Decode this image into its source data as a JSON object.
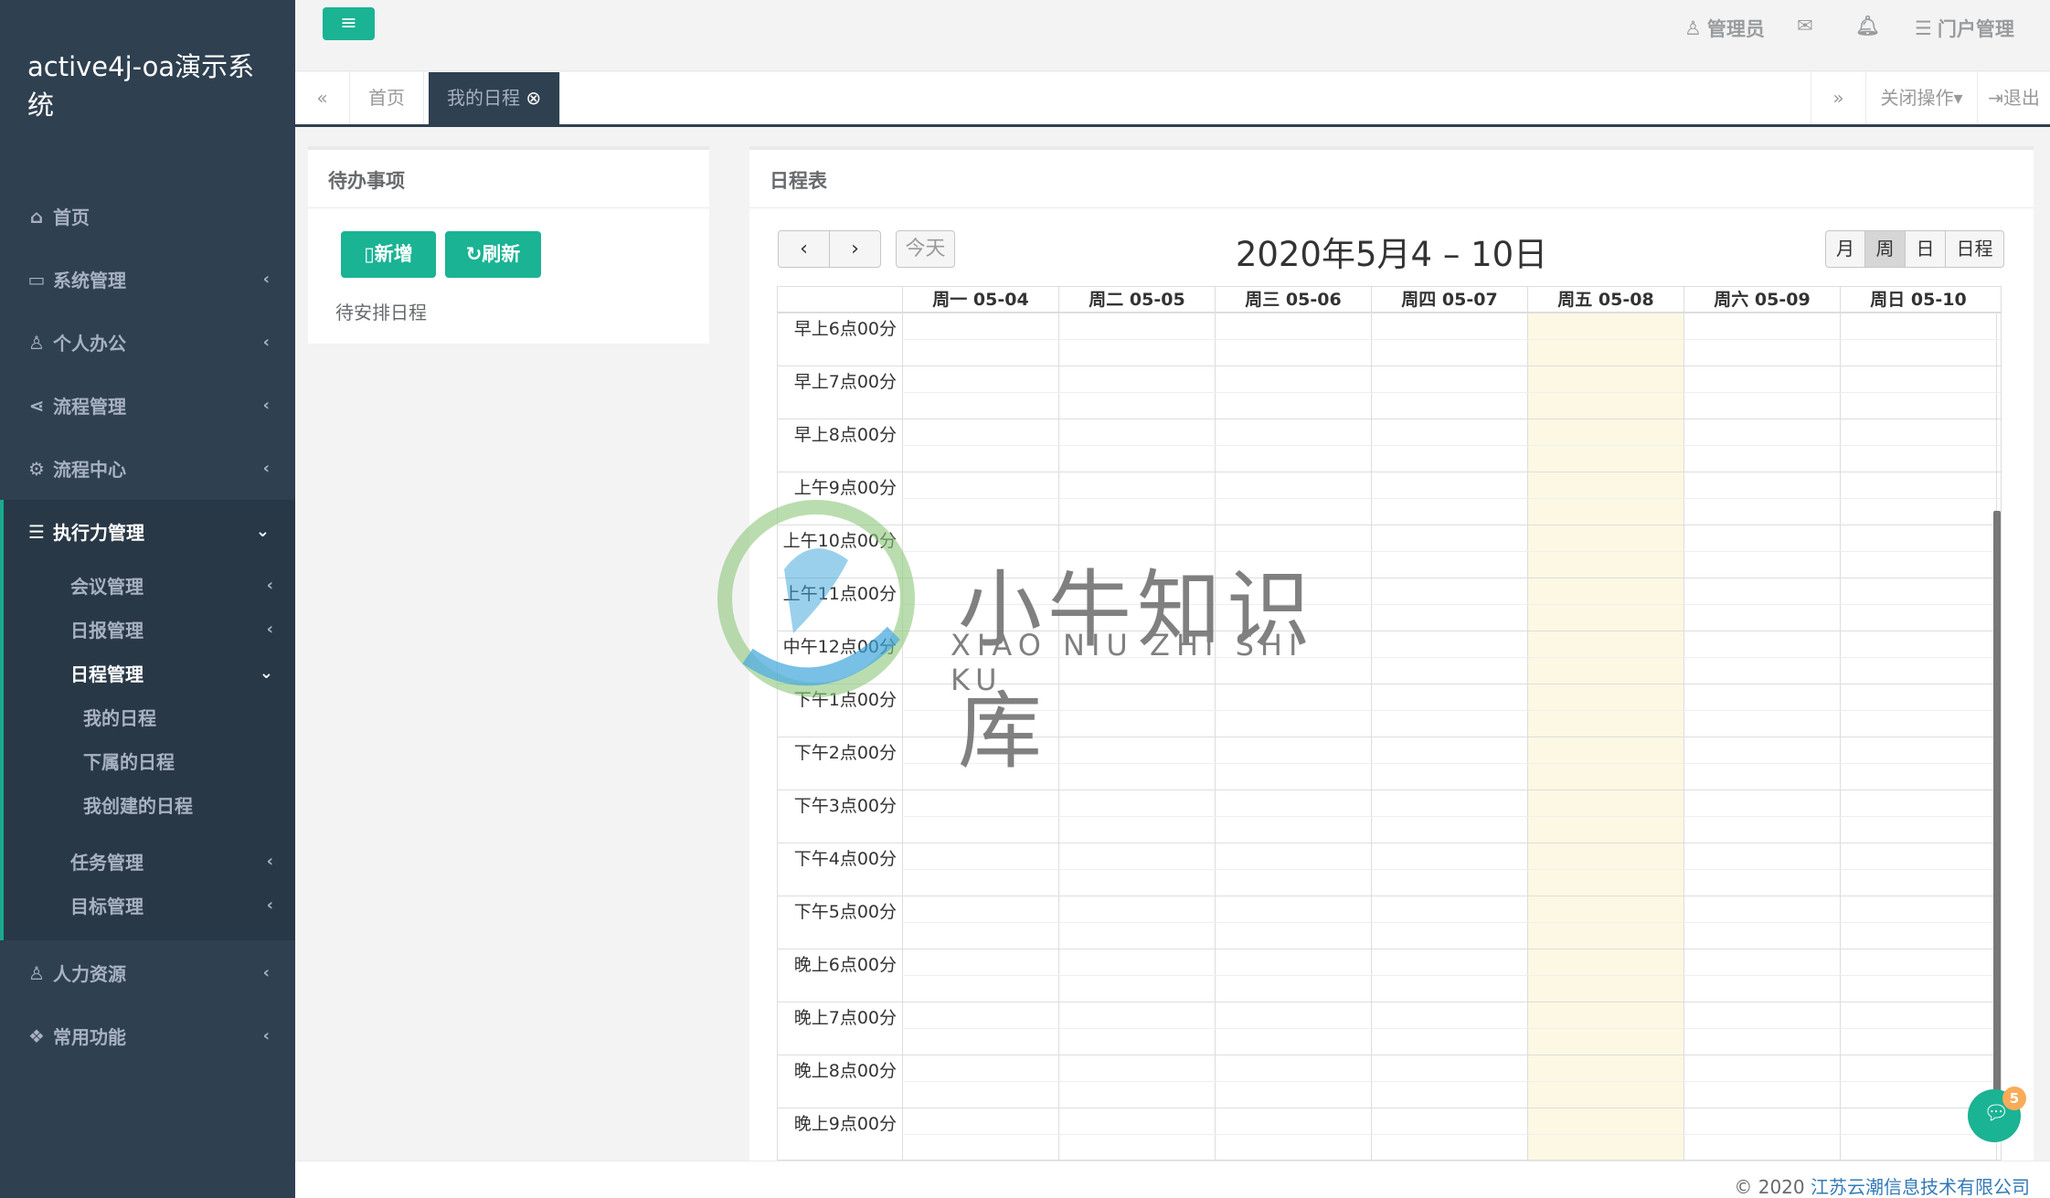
{
  "app": {
    "brand": "active4j-oa演示系统"
  },
  "topbar": {
    "user_label": "管理员",
    "portal_label": "门户管理"
  },
  "sidebar": {
    "items": [
      {
        "label": "首页",
        "icon": "home-icon"
      },
      {
        "label": "系统管理",
        "icon": "desktop-icon"
      },
      {
        "label": "个人办公",
        "icon": "user-icon"
      },
      {
        "label": "流程管理",
        "icon": "share-icon"
      },
      {
        "label": "流程中心",
        "icon": "gear-icon"
      },
      {
        "label": "执行力管理",
        "icon": "server-icon"
      },
      {
        "label": "人力资源",
        "icon": "user-plus-icon"
      },
      {
        "label": "常用功能",
        "icon": "cubes-icon"
      }
    ],
    "sub_items": [
      "会议管理",
      "日报管理",
      "日程管理",
      "任务管理",
      "目标管理"
    ],
    "leaf_items": [
      "我的日程",
      "下属的日程",
      "我创建的日程"
    ]
  },
  "tabs": {
    "items": [
      "首页",
      "我的日程"
    ],
    "close_ops_label": "关闭操作",
    "logout_label": "退出"
  },
  "todo": {
    "title": "待办事项",
    "add_label": "新增",
    "refresh_label": "刷新",
    "empty_text": "待安排日程"
  },
  "calendar": {
    "panel_title": "日程表",
    "title": "2020年5月4 – 10日",
    "today_label": "今天",
    "views": [
      "月",
      "周",
      "日",
      "日程"
    ],
    "active_view": "周",
    "days": [
      "周一 05-04",
      "周二 05-05",
      "周三 05-06",
      "周四 05-07",
      "周五 05-08",
      "周六 05-09",
      "周日 05-10"
    ],
    "today_day": "周五 05-08",
    "times": [
      "早上6点00分",
      "早上7点00分",
      "早上8点00分",
      "上午9点00分",
      "上午10点00分",
      "上午11点00分",
      "中午12点00分",
      "下午1点00分",
      "下午2点00分",
      "下午3点00分",
      "下午4点00分",
      "下午5点00分",
      "晚上6点00分",
      "晚上7点00分",
      "晚上8点00分",
      "晚上9点00分"
    ]
  },
  "watermark": {
    "text": "小牛知识库",
    "sub": "XIAO NIU ZHI SHI KU"
  },
  "footer": {
    "copyright": "© 2020 ",
    "company": "江苏云潮信息技术有限公司"
  },
  "chat": {
    "badge_count": "5"
  },
  "colors": {
    "sidebar": "#2f4050",
    "accent": "#1ab394",
    "today": "#fcf8e3"
  }
}
